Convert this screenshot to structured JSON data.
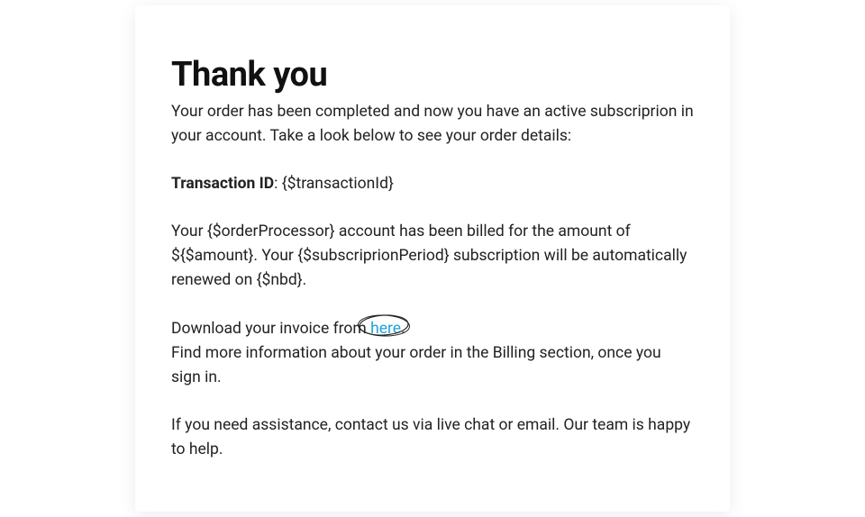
{
  "heading": "Thank you",
  "intro": "Your order has been completed and now you have an active subscriprion in your account. Take a look below to see your order details:",
  "transaction_label": "Transaction ID",
  "transaction_separator": ": ",
  "transaction_value": "{$transactionId}",
  "billing_text": "Your {$orderProcessor} account has been billed for the amount of ${$amount}. Your {$subscriprionPeriod} subscription will be automatically renewed on {$nbd}.",
  "download_prefix": "Download your invoice from ",
  "download_link_text": "here",
  "download_suffix": ".",
  "find_more_text": "Find more information about your order in the Billing section, once you sign in.",
  "assistance_text": "If you need assistance, contact us via live chat or email. Our team is happy to help."
}
